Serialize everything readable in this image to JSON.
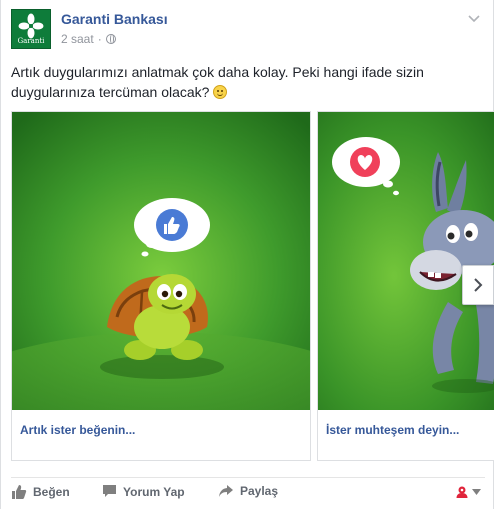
{
  "post": {
    "page_name": "Garanti Bankası",
    "timestamp": "2 saat",
    "separator": "·",
    "logo_text": "Garanti",
    "text": "Artık duygularımızı anlatmak çok daha kolay. Peki hangi ifade sizin duygularınıza tercüman olacak?"
  },
  "carousel": {
    "cards": [
      {
        "title": "Artık ister beğenin...",
        "reaction": "like-icon",
        "character": "turtle"
      },
      {
        "title": "İster muhteşem deyin...",
        "reaction": "heart-icon",
        "character": "donkey"
      }
    ]
  },
  "actions": {
    "like": "Beğen",
    "comment": "Yorum Yap",
    "share": "Paylaş"
  },
  "colors": {
    "link": "#365899",
    "card_green": "#3f9b2c",
    "like_blue": "#4a7bd5",
    "heart_red": "#f0405a"
  }
}
